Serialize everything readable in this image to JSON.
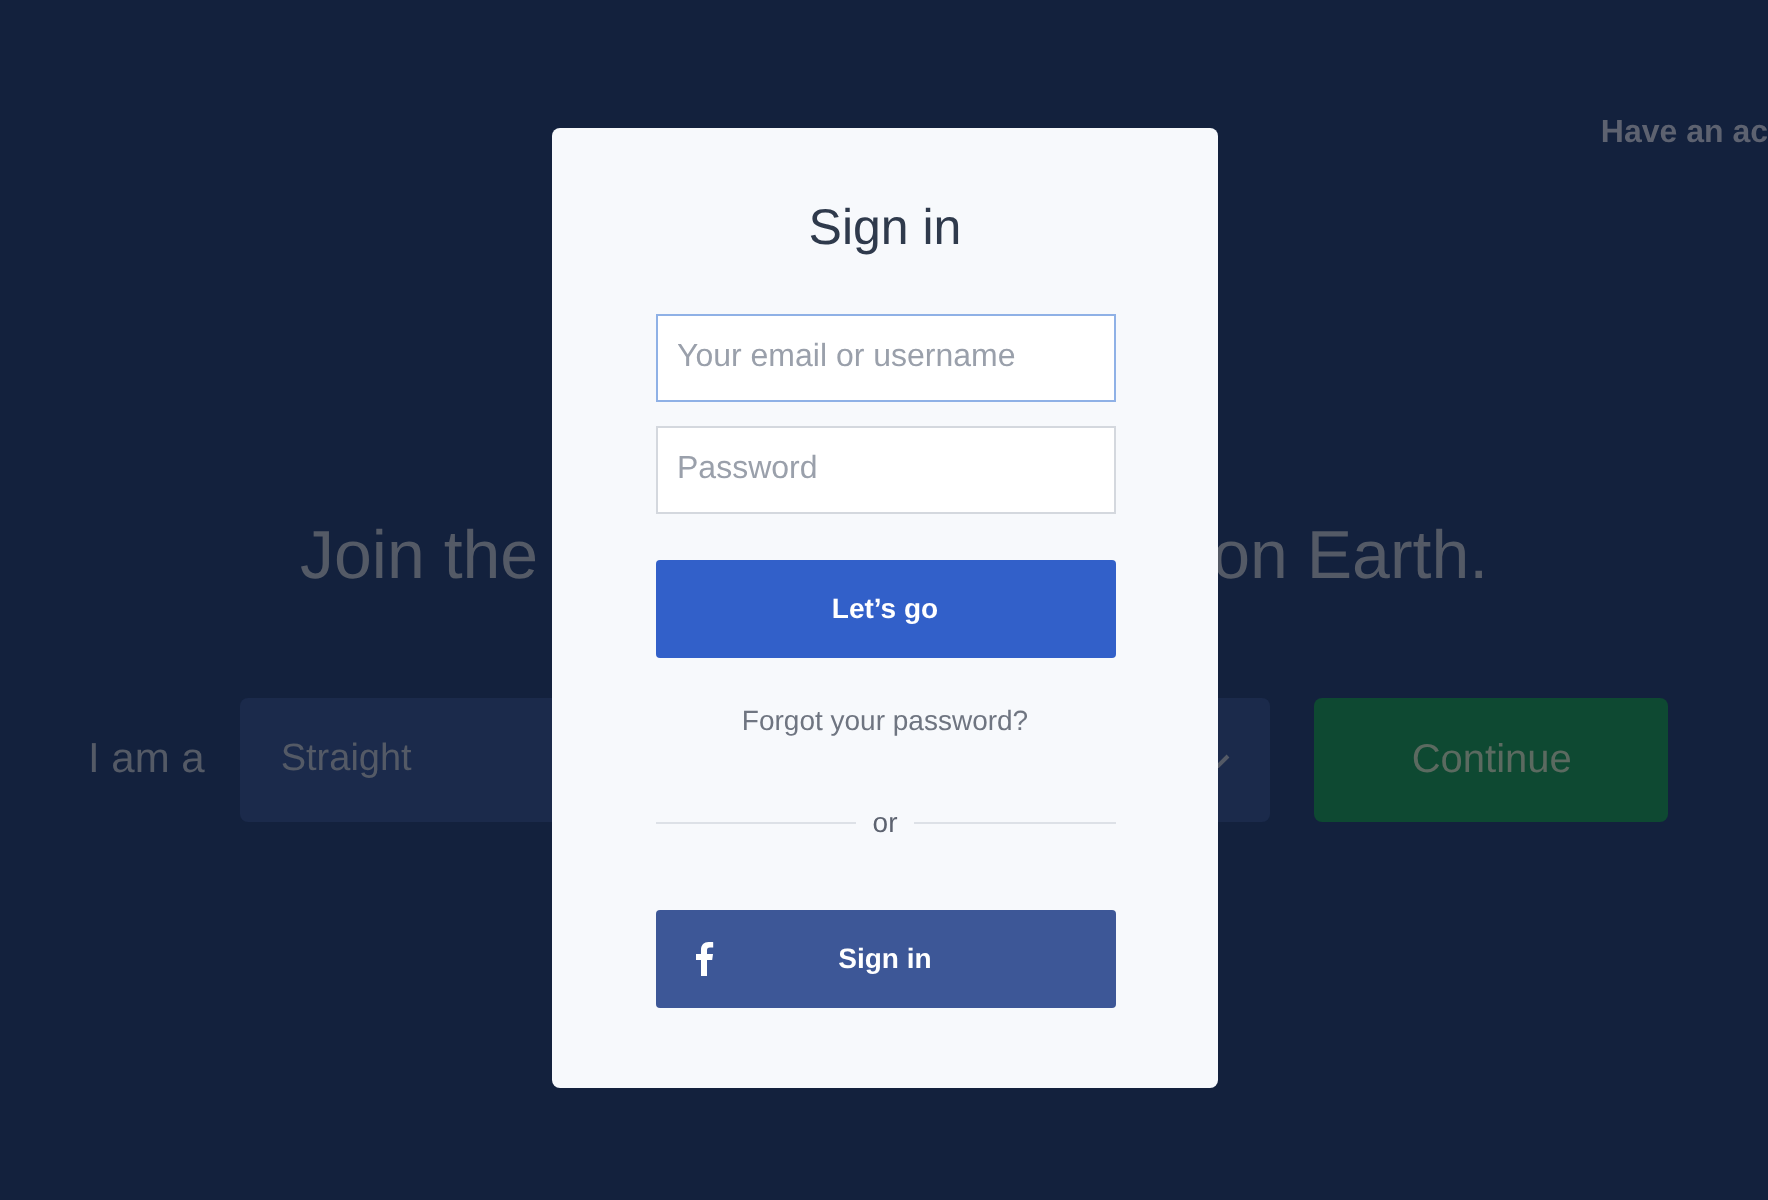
{
  "header": {
    "account_link": "Have an ac"
  },
  "headline": {
    "left": "Join the",
    "right": "on Earth."
  },
  "orientation_row": {
    "label": "I am a",
    "select_value": "Straight",
    "continue_button": "Continue"
  },
  "sign_in_dialog": {
    "title": "Sign in",
    "fields": [
      {
        "placeholder": "Your email or username",
        "focused": true
      },
      {
        "placeholder": "Password",
        "focused": false
      }
    ],
    "submit_button": "Let’s go",
    "forgot_link": "Forgot your password?",
    "divider_text": "or",
    "facebook_button": "Sign in"
  }
}
